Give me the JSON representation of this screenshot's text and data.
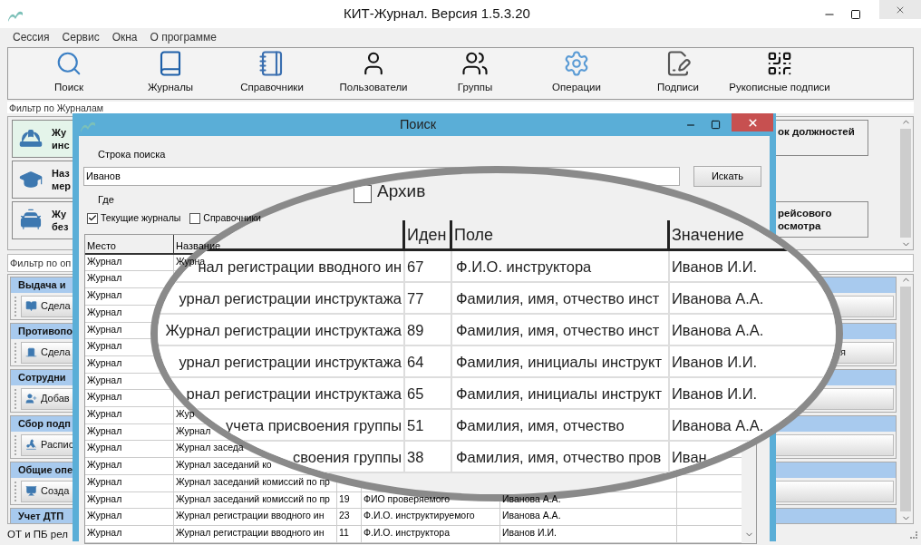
{
  "window": {
    "title": "КИТ-Журнал. Версия 1.5.3.20"
  },
  "menu": [
    "Сессия",
    "Сервис",
    "Окна",
    "О программе"
  ],
  "toolbar": [
    {
      "label": "Поиск"
    },
    {
      "label": "Журналы"
    },
    {
      "label": "Справочники"
    },
    {
      "label": "Пользователи"
    },
    {
      "label": "Группы"
    },
    {
      "label": "Операции"
    },
    {
      "label": "Подписи"
    },
    {
      "label": "Рукописные подписи"
    }
  ],
  "journal_filter": {
    "placeholder": "Фильтр по Журналам"
  },
  "journal_cards": [
    {
      "left": {
        "title": "Жу",
        "subtitle": "инс",
        "selected": true
      },
      "right": {
        "title": "ок должностей"
      }
    },
    {
      "left": {
        "title": "Наз",
        "subtitle": "мер",
        "selected": false
      }
    },
    {
      "left": {
        "title": "Жу",
        "subtitle": "без",
        "selected": false
      },
      "right": {
        "title": "рейсового",
        "subtitle": "осмотра"
      }
    }
  ],
  "operations_filter": {
    "placeholder": "Фильтр по оп"
  },
  "operation_groups": [
    {
      "title": "Выдача и",
      "button": {
        "label": "Сдела"
      }
    },
    {
      "title": "Противопо",
      "button": {
        "label": "Сдела",
        "tail": "я"
      }
    },
    {
      "title": "Сотрудни",
      "button": {
        "label": "Добав"
      }
    },
    {
      "title": "Сбор подп",
      "button": {
        "label": "Распис"
      }
    },
    {
      "title": "Общие опе",
      "button": {
        "label": "Созда"
      }
    },
    {
      "title": "Учет ДТП"
    }
  ],
  "status_bar": {
    "text": "ОТ и ПБ рел"
  },
  "search_dialog": {
    "title": "Поиск",
    "query_label": "Строка поиска",
    "query": "Иванов",
    "search_button": "Искать",
    "where_label": "Где",
    "scopes": [
      {
        "label": "Текущие журналы",
        "checked": true
      },
      {
        "label": "Справочники",
        "checked": false
      }
    ],
    "table": {
      "columns": [
        "Место",
        "Название"
      ],
      "rows": [
        {
          "place": "Журнал",
          "name": "Журна"
        },
        {
          "place": "Журнал"
        },
        {
          "place": "Журнал"
        },
        {
          "place": "Журнал"
        },
        {
          "place": "Журнал"
        },
        {
          "place": "Журнал"
        },
        {
          "place": "Журнал"
        },
        {
          "place": "Журнал"
        },
        {
          "place": "Журнал"
        },
        {
          "place": "Журнал",
          "name": "Жур"
        },
        {
          "place": "Журнал",
          "name": "Журнал"
        },
        {
          "place": "Журнал",
          "name": "Журнал заседа"
        },
        {
          "place": "Журнал",
          "name": "Журнал заседаний ко"
        },
        {
          "place": "Журнал",
          "name": "Журнал заседаний комиссий по пр"
        },
        {
          "place": "Журнал",
          "name": "Журнал заседаний комиссий по пр",
          "id": "19",
          "field": "ФИО проверяемого",
          "value": "Иванова А.А."
        },
        {
          "place": "Журнал",
          "name": "Журнал регистрации вводного ин",
          "id": "23",
          "field": "Ф.И.О. инструктируемого",
          "value": "Иванова А.А."
        },
        {
          "place": "Журнал",
          "name": "Журнал регистрации вводного ин",
          "id": "11",
          "field": "Ф.И.О. инструктора",
          "value": "Иванов И.И."
        }
      ]
    },
    "magnifier": {
      "archive": {
        "label": "Архив",
        "checked": false
      },
      "columns": [
        "Иден",
        "Поле",
        "Значение"
      ],
      "rows": [
        {
          "name": "нал регистрации вводного ин",
          "id": "67",
          "field": "Ф.И.О. инструктора",
          "value": "Иванов И.И."
        },
        {
          "name": "урнал регистрации инструктажа",
          "id": "77",
          "field": "Фамилия, имя, отчество инст",
          "value": "Иванова А.А."
        },
        {
          "name": "Журнал регистрации инструктажа",
          "id": "89",
          "field": "Фамилия, имя, отчество инст",
          "value": "Иванова А.А."
        },
        {
          "name": "урнал регистрации инструктажа",
          "id": "64",
          "field": "Фамилия, инициалы инструкт",
          "value": "Иванов И.И."
        },
        {
          "name": "рнал регистрации инструктажа",
          "id": "65",
          "field": "Фамилия, инициалы инструкт",
          "value": "Иванов И.И."
        },
        {
          "name": "учета присвоения группы",
          "id": "51",
          "field": "Фамилия, имя, отчество",
          "value": "Иванова А.А."
        },
        {
          "name": "своения группы",
          "id": "38",
          "field": "Фамилия, имя, отчество пров",
          "value": "Иван"
        }
      ]
    }
  }
}
